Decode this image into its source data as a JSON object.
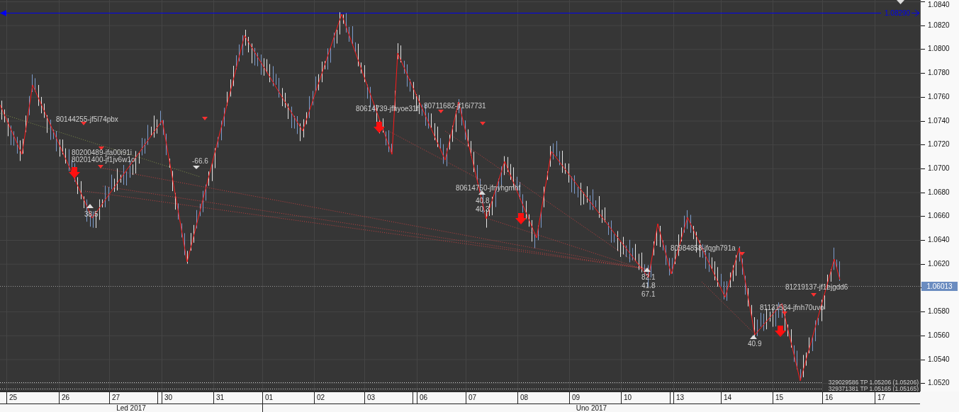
{
  "chart": {
    "price_line": {
      "label": "1.08290"
    },
    "current_price": "1.06013",
    "labels": [
      {
        "text": "80144255-jf5l74pbx"
      },
      {
        "text": "80200489-jfa00i91i"
      },
      {
        "text": "80201400-jf1jv6w1o"
      },
      {
        "text": "-66.6"
      },
      {
        "text": "38.5"
      },
      {
        "text": "80614739-jfhyoe31f"
      },
      {
        "text": "80711682-jf16i7731"
      },
      {
        "text": "80614750-jfnyhgmhf"
      },
      {
        "text": "40.8"
      },
      {
        "text": "40.3"
      },
      {
        "text": "82.1"
      },
      {
        "text": "41.8"
      },
      {
        "text": "67.1"
      },
      {
        "text": "80984858-jfqgh791a"
      },
      {
        "text": "40.9"
      },
      {
        "text": "81131584-jfnh70uvo"
      },
      {
        "text": "81219137-jf1ejgdd6"
      }
    ],
    "take_profit_lines": [
      "329029586 TP 1.05206 (1.05206)",
      "329371381 TP 1.05165 (1.05165)"
    ]
  },
  "price_axis": [
    "1.0840",
    "1.0820",
    "1.0800",
    "1.0780",
    "1.0760",
    "1.0740",
    "1.0720",
    "1.0700",
    "1.0680",
    "1.0660",
    "1.0640",
    "1.0620",
    "1.0580",
    "1.0560",
    "1.0540",
    "1.0520"
  ],
  "date_axis": [
    "25",
    "26",
    "27",
    "30",
    "31",
    "01",
    "02",
    "03",
    "06",
    "07",
    "08",
    "09",
    "10",
    "13",
    "14",
    "15",
    "16",
    "17"
  ],
  "month_axis": [
    "Led 2017",
    "Uno 2017"
  ]
}
